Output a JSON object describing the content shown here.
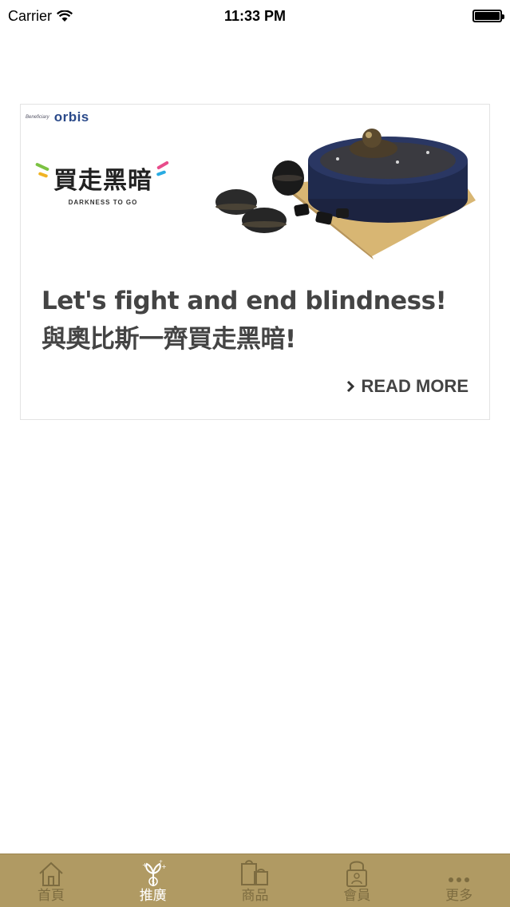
{
  "status_bar": {
    "carrier": "Carrier",
    "time": "11:33 PM"
  },
  "card": {
    "brand_small": "Beneficiary",
    "brand_name": "orbis",
    "campaign_title": "買走黑暗",
    "campaign_subtitle": "DARKNESS TO GO",
    "title": "Let's fight and end blindness! 與奧比斯一齊買走黑暗!",
    "read_more": "READ MORE"
  },
  "tab_bar": {
    "tabs": [
      {
        "label": "首頁",
        "icon": "home-icon",
        "active": false
      },
      {
        "label": "推廣",
        "icon": "promotion-icon",
        "active": true
      },
      {
        "label": "商品",
        "icon": "shopping-icon",
        "active": false
      },
      {
        "label": "會員",
        "icon": "member-lock-icon",
        "active": false
      },
      {
        "label": "更多",
        "icon": "more-icon",
        "active": false
      }
    ]
  },
  "colors": {
    "tab_bar_bg": "#b09a63",
    "tab_inactive": "#7d6c40",
    "tab_active": "#ffffff",
    "brand_blue": "#2b4a8a"
  }
}
